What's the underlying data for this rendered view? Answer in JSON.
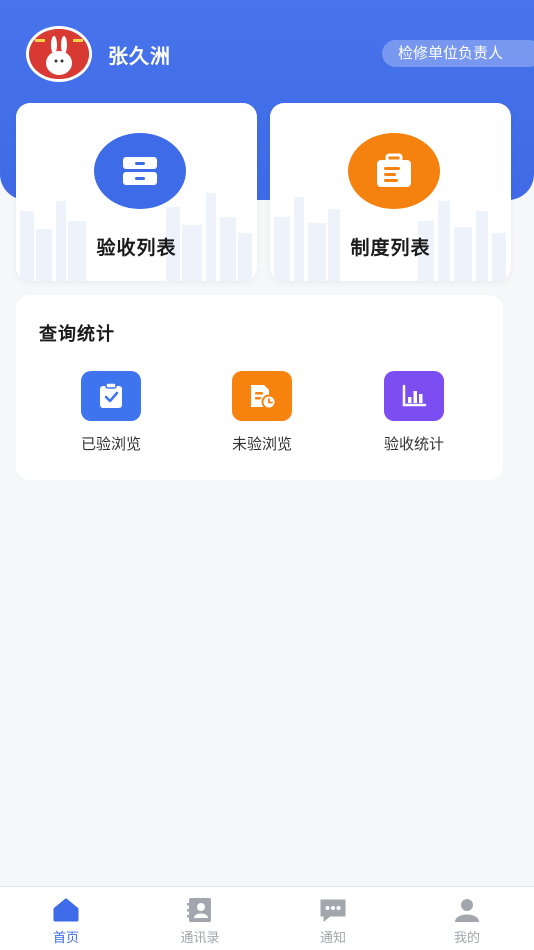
{
  "header": {
    "user_name": "张久洲",
    "role": "检修单位负责人",
    "avatar_icon": "avatar-image",
    "brand_color": "#4773ec"
  },
  "cards": [
    {
      "label": "验收列表",
      "icon": "drawer-icon",
      "color": "#3e6be8"
    },
    {
      "label": "制度列表",
      "icon": "briefcase-document-icon",
      "color": "#f5820f"
    }
  ],
  "stats": {
    "title": "查询统计",
    "items": [
      {
        "label": "已验浏览",
        "icon": "clipboard-check-icon",
        "color": "#3e74ee"
      },
      {
        "label": "未验浏览",
        "icon": "document-clock-icon",
        "color": "#f7830f"
      },
      {
        "label": "验收统计",
        "icon": "bar-chart-icon",
        "color": "#7c4df0"
      }
    ]
  },
  "tabbar": {
    "active_color": "#3e6be8",
    "inactive_color": "#a3a6ad",
    "tabs": [
      {
        "label": "首页",
        "icon": "home-icon",
        "active": true
      },
      {
        "label": "通讯录",
        "icon": "contacts-icon",
        "active": false
      },
      {
        "label": "通知",
        "icon": "message-icon",
        "active": false
      },
      {
        "label": "我的",
        "icon": "user-icon",
        "active": false
      }
    ]
  }
}
